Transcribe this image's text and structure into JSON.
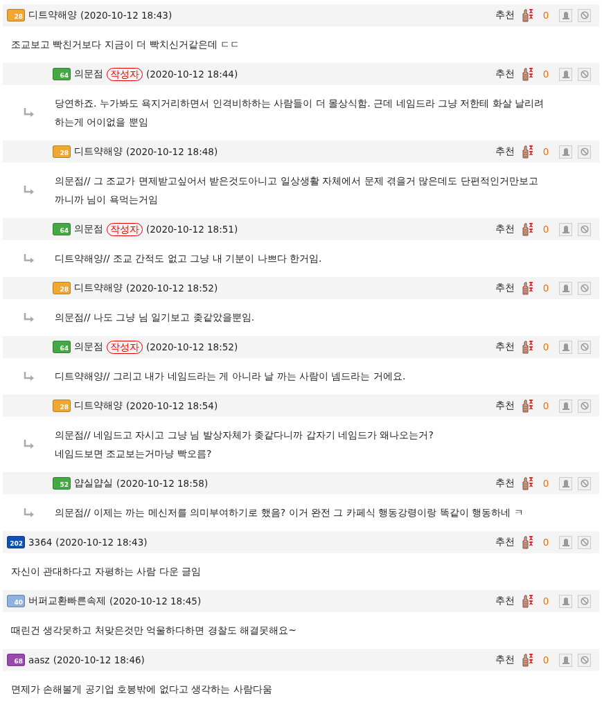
{
  "comments": [
    {
      "kind": "comment",
      "badge": "28",
      "color": "#f0a830",
      "author": "디트약해양",
      "time": "(2020-10-12 18:43)",
      "vote_label": "추천",
      "votes": "0",
      "body": "조교보고 빡친거보다 지금이 더 빡치신거같은데 ㄷㄷ"
    },
    {
      "kind": "reply",
      "badge": "64",
      "color": "#44a844",
      "author": "의문점",
      "writer_tag": "작성자",
      "time": "(2020-10-12 18:44)",
      "vote_label": "추천",
      "votes": "0",
      "body": "당연하죠. 누가봐도 욕지거리하면서 인격비하하는 사람들이 더 몰상식함. 근데 네임드라 그냥 저한테 화살 날리려\n하는게 어이없을 뿐임"
    },
    {
      "kind": "reply",
      "badge": "28",
      "color": "#f0a830",
      "author": "디트약해양",
      "time": "(2020-10-12 18:48)",
      "vote_label": "추천",
      "votes": "0",
      "body": "의문점// 그 조교가 면제받고싶어서 받은것도아니고 일상생활 자체에서 문제 겪을거 많은데도 단편적인거만보고\n까니까 님이 욕먹는거임"
    },
    {
      "kind": "reply",
      "badge": "64",
      "color": "#44a844",
      "author": "의문점",
      "writer_tag": "작성자",
      "time": "(2020-10-12 18:51)",
      "vote_label": "추천",
      "votes": "0",
      "body": "디트약해양// 조교 간적도 없고 그냥 내 기분이 나쁘다 한거임."
    },
    {
      "kind": "reply",
      "badge": "28",
      "color": "#f0a830",
      "author": "디트약해양",
      "time": "(2020-10-12 18:52)",
      "vote_label": "추천",
      "votes": "0",
      "body": "의문점// 나도 그냥 님 일기보고 좆같았을뿐임."
    },
    {
      "kind": "reply",
      "badge": "64",
      "color": "#44a844",
      "author": "의문점",
      "writer_tag": "작성자",
      "time": "(2020-10-12 18:52)",
      "vote_label": "추천",
      "votes": "0",
      "body": "디트약해양// 그리고 내가 네임드라는 게 아니라 날 까는 사람이 넴드라는 거에요."
    },
    {
      "kind": "reply",
      "badge": "28",
      "color": "#f0a830",
      "author": "디트약해양",
      "time": "(2020-10-12 18:54)",
      "vote_label": "추천",
      "votes": "0",
      "body": "의문점// 네임드고 자시고 그냥 님 발상자체가 좆같다니까 갑자기 네임드가 왜나오는거?\n네임드보면 조교보는거마냥 빡오름?"
    },
    {
      "kind": "reply",
      "badge": "52",
      "color": "#44a844",
      "author": "얍실얍실",
      "time": "(2020-10-12 18:58)",
      "vote_label": "추천",
      "votes": "0",
      "body": "의문점// 이제는 까는 메신저를 의미부여하기로 했음? 이거 완전 그 카페식 행동강령이랑 똑같이 행동하네 ㅋ"
    },
    {
      "kind": "comment",
      "badge": "202",
      "color": "#1050b0",
      "author": "3364",
      "time": "(2020-10-12 18:43)",
      "vote_label": "추천",
      "votes": "0",
      "body": "자신이 관대하다고 자평하는 사람 다운 글임"
    },
    {
      "kind": "comment",
      "badge": "40",
      "color": "#90b0e0",
      "author": "버퍼교환빠른속제",
      "time": "(2020-10-12 18:45)",
      "vote_label": "추천",
      "votes": "0",
      "body": "때린건 생각못하고 처맞은것만 억울하다하면 경찰도 해결못해요~"
    },
    {
      "kind": "comment",
      "badge": "68",
      "color": "#9848b0",
      "author": "aasz",
      "time": "(2020-10-12 18:46)",
      "vote_label": "추천",
      "votes": "0",
      "body": "면제가 손해볼게 공기업 호봉밖에 없다고 생각하는 사람다움"
    }
  ]
}
